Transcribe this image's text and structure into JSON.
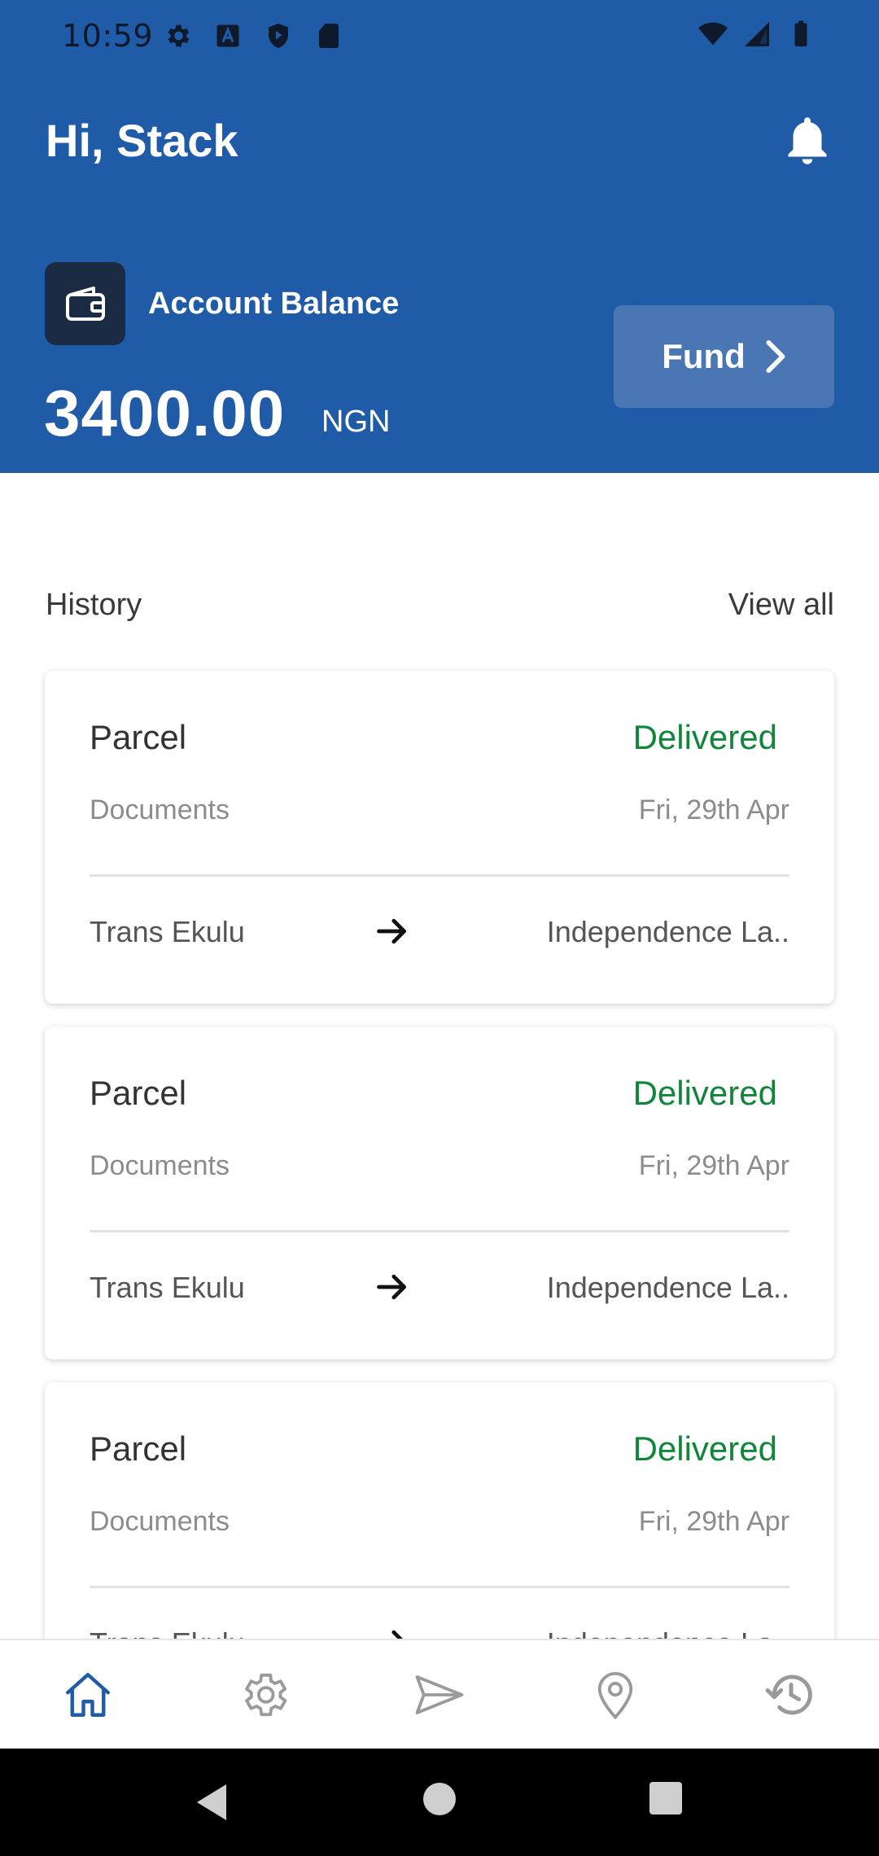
{
  "status_bar": {
    "time": "10:59",
    "left_icons": [
      "gear-icon",
      "keyboard-a-icon",
      "shield-play-icon",
      "sd-card-icon"
    ],
    "right_icons": [
      "wifi-icon",
      "signal-icon",
      "battery-icon"
    ]
  },
  "header": {
    "greeting": "Hi, Stack",
    "notification_icon": "bell-icon",
    "balance_label": "Account Balance",
    "balance_value": "3400.00",
    "balance_currency": "NGN",
    "fund_label": "Fund",
    "colors": {
      "primary": "#1f5ba7",
      "fund_button": "#4a76b4",
      "wallet_box": "#1c2b44"
    }
  },
  "history": {
    "title": "History",
    "view_all": "View all",
    "items": [
      {
        "type": "Parcel",
        "status": "Delivered",
        "category": "Documents",
        "date": "Fri, 29th Apr",
        "from": "Trans Ekulu",
        "to": "Independence La.."
      },
      {
        "type": "Parcel",
        "status": "Delivered",
        "category": "Documents",
        "date": "Fri, 29th Apr",
        "from": "Trans Ekulu",
        "to": "Independence La.."
      },
      {
        "type": "Parcel",
        "status": "Delivered",
        "category": "Documents",
        "date": "Fri, 29th Apr",
        "from": "Trans Ekulu",
        "to": "Independence La.."
      }
    ],
    "status_color": "#11853a"
  },
  "bottom_nav": {
    "items": [
      {
        "icon": "home-icon",
        "active": true
      },
      {
        "icon": "settings-icon",
        "active": false
      },
      {
        "icon": "send-icon",
        "active": false
      },
      {
        "icon": "location-icon",
        "active": false
      },
      {
        "icon": "history-icon",
        "active": false
      }
    ],
    "active_color": "#1f5ba7",
    "inactive_color": "#9a9a9a"
  },
  "system_nav": [
    "back-icon",
    "home-circle-icon",
    "recents-icon"
  ]
}
